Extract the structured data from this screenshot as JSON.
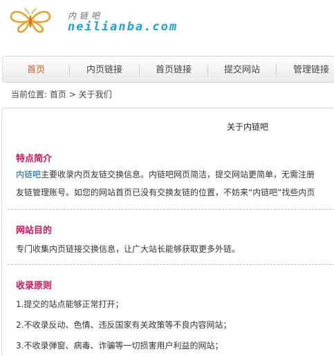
{
  "logo": {
    "cn": "内链吧",
    "en": "neilianba.com"
  },
  "nav": {
    "items": [
      {
        "label": "首页",
        "active": true
      },
      {
        "label": "内页链接",
        "active": false
      },
      {
        "label": "首页链接",
        "active": false
      },
      {
        "label": "提交网站",
        "active": false
      },
      {
        "label": "管理链接",
        "active": false
      }
    ]
  },
  "breadcrumb": {
    "prefix": "当前位置:",
    "home": "首页",
    "sep": ">",
    "current": "关于我们"
  },
  "content": {
    "title": "关于内链吧",
    "sections": [
      {
        "heading": "特点简介",
        "link": "内链吧",
        "line1": "主要收录内页友链交换信息。内链吧网页简洁，提交网站更简单，无需注册",
        "line2": "友链管理账号。如您的网站首页已没有交换友链的位置，不妨来“内链吧”找些内页"
      },
      {
        "heading": "网站目的",
        "line1": "专门收集内页链接交换信息，让广大站长能够获取更多外链。"
      },
      {
        "heading": "收录原则",
        "items": [
          "1.提交的站点能够正常打开；",
          "2.不收录反动、色情、违反国家有关政策等不良内容网站；",
          "3.不收录弹窗、病毒、诈骗等一切损害用户利益的网站；"
        ]
      }
    ]
  },
  "colors": {
    "nav_active": "#e6551e",
    "section_heading": "#d1145a",
    "link": "#0b5ea8",
    "logo_text": "#1aa3d9",
    "logo_wings": "#e8a22a"
  }
}
